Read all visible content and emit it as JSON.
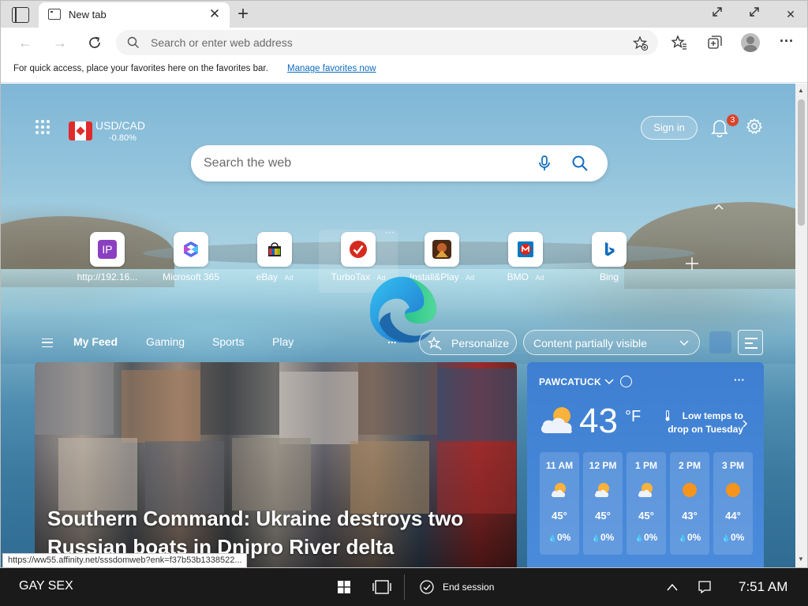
{
  "tab": {
    "title": "New tab"
  },
  "address_bar": {
    "placeholder": "Search or enter web address"
  },
  "favorites_bar": {
    "message": "For quick access, place your favorites here on the favorites bar.",
    "link": "Manage favorites now"
  },
  "currency": {
    "pair": "USD/CAD",
    "change": "-0.80%"
  },
  "header": {
    "sign_in": "Sign in",
    "notification_count": "3"
  },
  "web_search": {
    "placeholder": "Search the web"
  },
  "quick_links": [
    {
      "label": "http://192.16...",
      "ad": "",
      "icon": "ip-icon",
      "color": "#8a3fc1"
    },
    {
      "label": "Microsoft 365",
      "ad": "",
      "icon": "microsoft-365-icon",
      "color": "#5a6cf0"
    },
    {
      "label": "eBay",
      "ad": "· Ad",
      "icon": "ebay-icon",
      "color": "#e53238"
    },
    {
      "label": "TurboTax",
      "ad": "· Ad",
      "icon": "turbotax-icon",
      "color": "#d52b1e"
    },
    {
      "label": "Install&Play",
      "ad": "· Ad",
      "icon": "install-play-icon",
      "color": "#b3461d"
    },
    {
      "label": "BMO",
      "ad": "· Ad",
      "icon": "bmo-icon",
      "color": "#0079c1"
    },
    {
      "label": "Bing",
      "ad": "",
      "icon": "bing-icon",
      "color": "#0f6cbd"
    }
  ],
  "quick_link_ip_text": "IP",
  "feed_nav": {
    "tabs": [
      "My Feed",
      "Gaming",
      "Sports",
      "Play"
    ],
    "more": "...",
    "personalize": "Personalize",
    "visibility": "Content partially visible"
  },
  "hero": {
    "headline": "Southern Command: Ukraine destroys two Russian boats in Dnipro River delta"
  },
  "weather": {
    "location": "PAWCATUCK",
    "temp": "43",
    "unit": "°F",
    "alert_line1": "Low temps to",
    "alert_line2": "drop on Tuesday",
    "more": "···",
    "hours": [
      {
        "time": "11 AM",
        "temp": "45°",
        "precip": "0%",
        "icon": "partly-cloudy-icon"
      },
      {
        "time": "12 PM",
        "temp": "45°",
        "precip": "0%",
        "icon": "partly-cloudy-icon"
      },
      {
        "time": "1 PM",
        "temp": "45°",
        "precip": "0%",
        "icon": "partly-cloudy-icon"
      },
      {
        "time": "2 PM",
        "temp": "43°",
        "precip": "0%",
        "icon": "sunny-icon"
      },
      {
        "time": "3 PM",
        "temp": "44°",
        "precip": "0%",
        "icon": "sunny-icon"
      }
    ],
    "precip_glyph": "💧"
  },
  "status_url": "https://ww55.affinity.net/sssdomweb?enk=f37b53b1338522...",
  "taskbar": {
    "session_name": "GAY SEX",
    "end_session": "End session",
    "clock": "7:51 AM"
  },
  "colors": {
    "accent": "#0f6cbd",
    "weather_bg": "#4589d8",
    "notification_badge": "#d9442c",
    "taskbar": "#1a1a1a"
  }
}
